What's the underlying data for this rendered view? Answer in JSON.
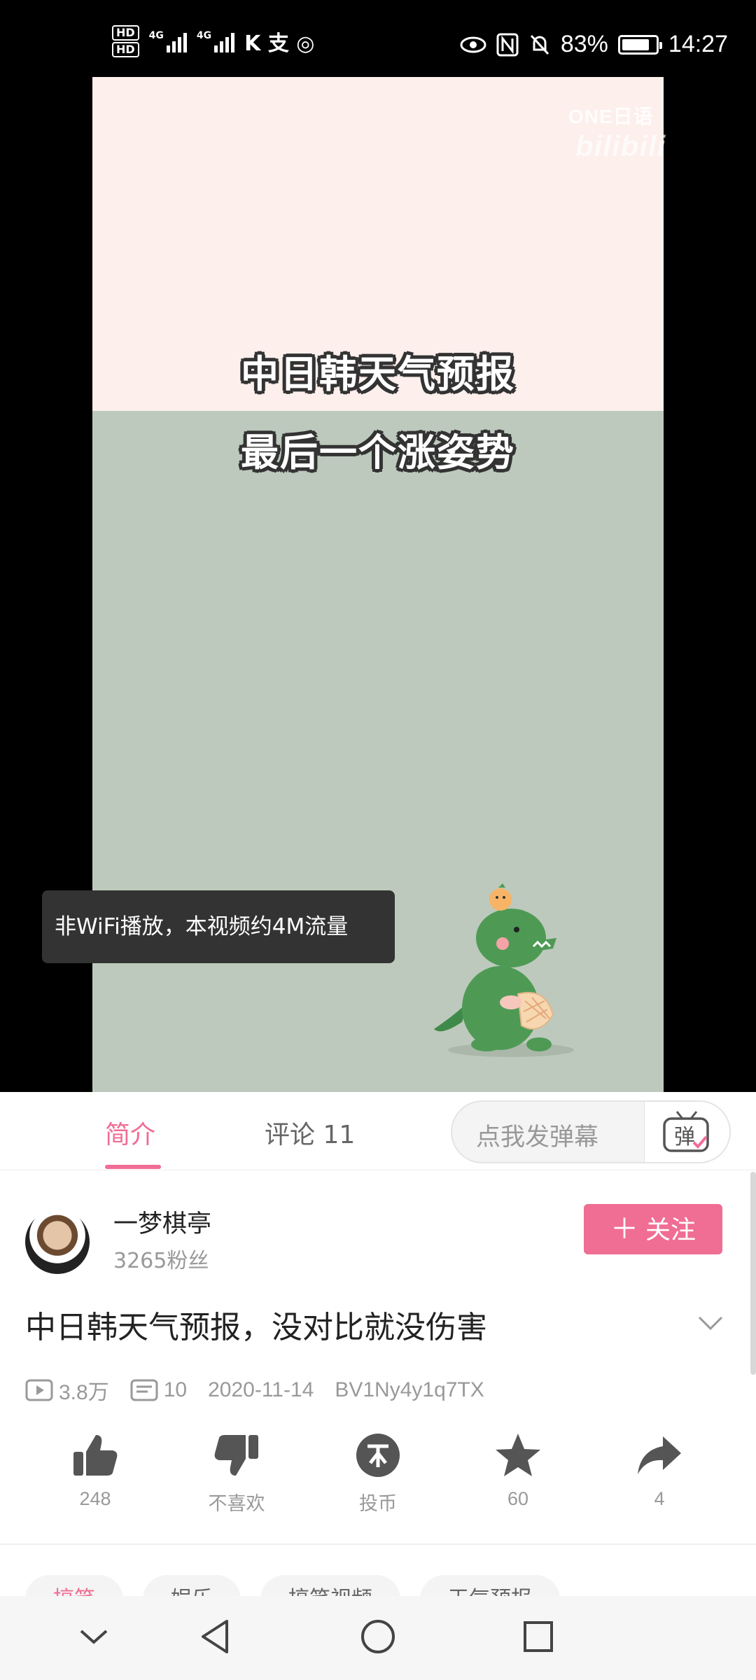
{
  "status_bar": {
    "hd1": "HD",
    "hd2": "HD",
    "net1": "4G",
    "net2": "4G",
    "extra_icons": "K 支 ◎",
    "battery_percent": "83%",
    "battery_level": 0.83,
    "time": "14:27"
  },
  "video": {
    "watermark": "ONE日语",
    "watermark_brand": "bilibili",
    "caption_line1": "中日韩天气预报",
    "caption_line2": "最后一个涨姿势",
    "toast": "非WiFi播放，本视频约4M流量"
  },
  "tabs": {
    "intro": "简介",
    "comments": "评论 11"
  },
  "danmaku": {
    "placeholder": "点我发弹幕",
    "button_icon": "弹"
  },
  "uploader": {
    "name": "一梦棋亭",
    "fans": "3265粉丝",
    "follow_label": "关注"
  },
  "video_info": {
    "title": "中日韩天气预报，没对比就没伤害",
    "views": "3.8万",
    "danmaku_count": "10",
    "date": "2020-11-14",
    "bvid": "BV1Ny4y1q7TX"
  },
  "actions": {
    "like": "248",
    "dislike": "不喜欢",
    "coin": "投币",
    "favorite": "60",
    "share": "4"
  },
  "tags": [
    "搞笑",
    "娱乐",
    "搞笑视频",
    "天气预报"
  ],
  "colors": {
    "accent": "#f06d94",
    "video_top": "#fcefec",
    "video_bottom": "#bdc9bc"
  }
}
